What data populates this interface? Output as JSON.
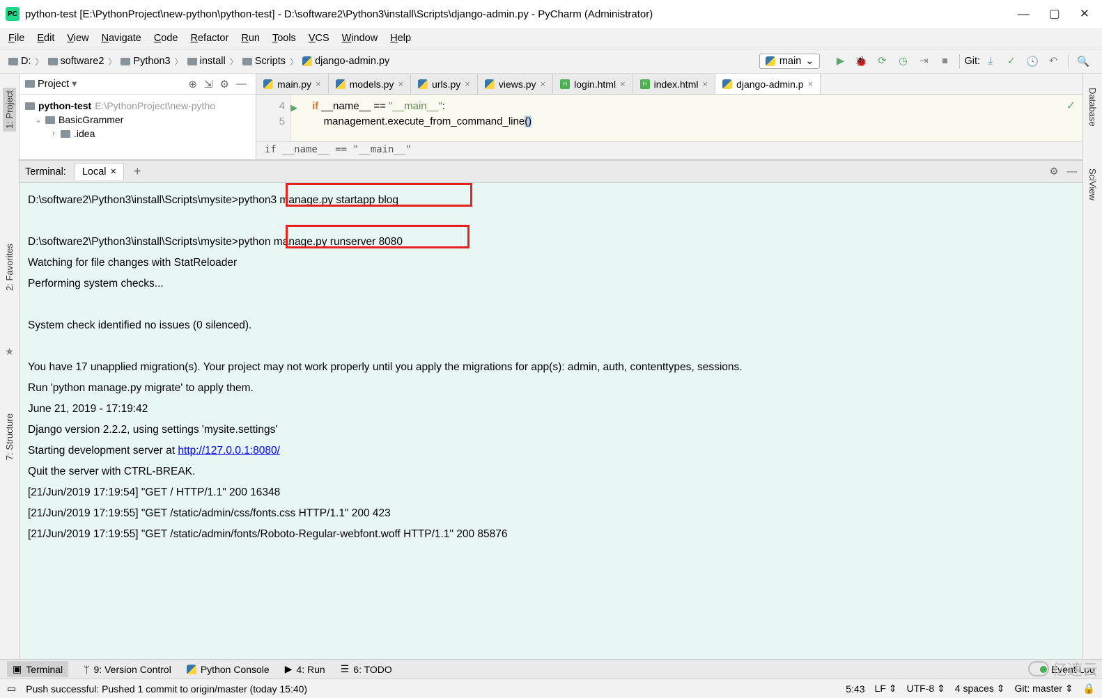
{
  "window": {
    "title": "python-test [E:\\PythonProject\\new-python\\python-test] - D:\\software2\\Python3\\install\\Scripts\\django-admin.py - PyCharm (Administrator)",
    "app_icon_text": "PC"
  },
  "menu": {
    "file": "File",
    "edit": "Edit",
    "view": "View",
    "navigate": "Navigate",
    "code": "Code",
    "refactor": "Refactor",
    "run": "Run",
    "tools": "Tools",
    "vcs": "VCS",
    "window": "Window",
    "help": "Help"
  },
  "nav": {
    "crumbs": [
      "D:",
      "software2",
      "Python3",
      "install",
      "Scripts"
    ],
    "crumb_file": "django-admin.py",
    "run_config": "main",
    "git_label": "Git:"
  },
  "project": {
    "label": "Project",
    "root_name": "python-test",
    "root_path": "E:\\PythonProject\\new-pytho",
    "child1": "BasicGrammer",
    "child2": ".idea"
  },
  "editor": {
    "tabs": [
      {
        "name": "main.py",
        "type": "py"
      },
      {
        "name": "models.py",
        "type": "py"
      },
      {
        "name": "urls.py",
        "type": "py"
      },
      {
        "name": "views.py",
        "type": "py"
      },
      {
        "name": "login.html",
        "type": "html"
      },
      {
        "name": "index.html",
        "type": "html"
      },
      {
        "name": "django-admin.p",
        "type": "py",
        "active": true
      }
    ],
    "gutter": {
      "l4": "4",
      "l5": "5"
    },
    "code_l4_pre": "if ",
    "code_l4_name": "__name__",
    "code_l4_eq": " == ",
    "code_l4_str": "\"__main__\"",
    "code_l4_post": ":",
    "code_l5_pre": "    management.",
    "code_l5_call": "execute_from_command_line",
    "code_l5_paren": "()",
    "breadcrumb": "if __name__ == \"__main__\""
  },
  "rails": {
    "project": "1: Project",
    "favorites": "2: Favorites",
    "structure": "7: Structure",
    "database": "Database",
    "sciview": "SciView"
  },
  "terminal": {
    "label": "Terminal:",
    "tab_name": "Local",
    "add_label": "+",
    "prompt": "D:\\software2\\Python3\\install\\Scripts\\mysite>",
    "cmd1": "python3 manage.py startapp blog",
    "cmd2": "python manage.py runserver 8080",
    "out1": "Watching for file changes with StatReloader",
    "out2": "Performing system checks...",
    "out3": "System check identified no issues (0 silenced).",
    "out4": "You have 17 unapplied migration(s). Your project may not work properly until you apply the migrations for app(s): admin, auth, contenttypes, sessions.",
    "out5": "Run 'python manage.py migrate' to apply them.",
    "out6": "June 21, 2019 - 17:19:42",
    "out7": "Django version 2.2.2, using settings 'mysite.settings'",
    "out8_pre": "Starting development server at ",
    "out8_link": "http://127.0.0.1:8080/",
    "out9": "Quit the server with CTRL-BREAK.",
    "out10": "[21/Jun/2019 17:19:54] \"GET / HTTP/1.1\" 200 16348",
    "out11": "[21/Jun/2019 17:19:55] \"GET /static/admin/css/fonts.css HTTP/1.1\" 200 423",
    "out12": "[21/Jun/2019 17:19:55] \"GET /static/admin/fonts/Roboto-Regular-webfont.woff HTTP/1.1\" 200 85876"
  },
  "bottom": {
    "terminal": "Terminal",
    "vcs": "9: Version Control",
    "pyconsole": "Python Console",
    "run": "4: Run",
    "todo": "6: TODO",
    "eventlog": "Event Log"
  },
  "status": {
    "message": "Push successful: Pushed 1 commit to origin/master (today 15:40)",
    "pos": "5:43",
    "lineend": "LF",
    "encoding": "UTF-8",
    "indent": "4 spaces",
    "git": "Git: master"
  },
  "watermark": "亿速云"
}
